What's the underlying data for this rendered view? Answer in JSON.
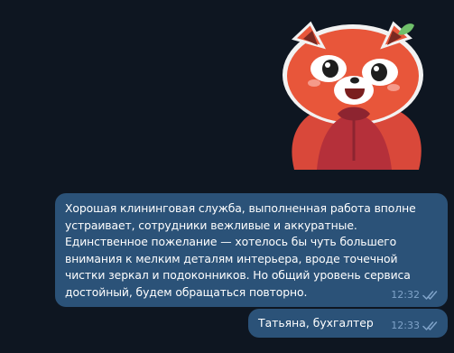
{
  "chat": {
    "messages": [
      {
        "text": "Хорошая клининговая служба, выполненная работа вполне устраивает, сотрудники вежливые и аккуратные. Единственное пожелание — хотелось бы чуть большего внимания к мелким деталям интерьера, вроде точечной чистки зеркал и подоконников. Но общий уровень сервиса достойный, будем обращаться повторно.",
        "time": "12:32",
        "status_icon": "double-check-icon"
      },
      {
        "text": "Татьяна, бухгалтер",
        "time": "12:33",
        "status_icon": "double-check-icon"
      }
    ],
    "sticker_icon": "red-panda-sticker",
    "colors": {
      "background": "#0e1621",
      "outgoing_bubble": "#2b5278",
      "meta_text": "#7fa3c9",
      "panda_red": "#e8563a"
    }
  }
}
